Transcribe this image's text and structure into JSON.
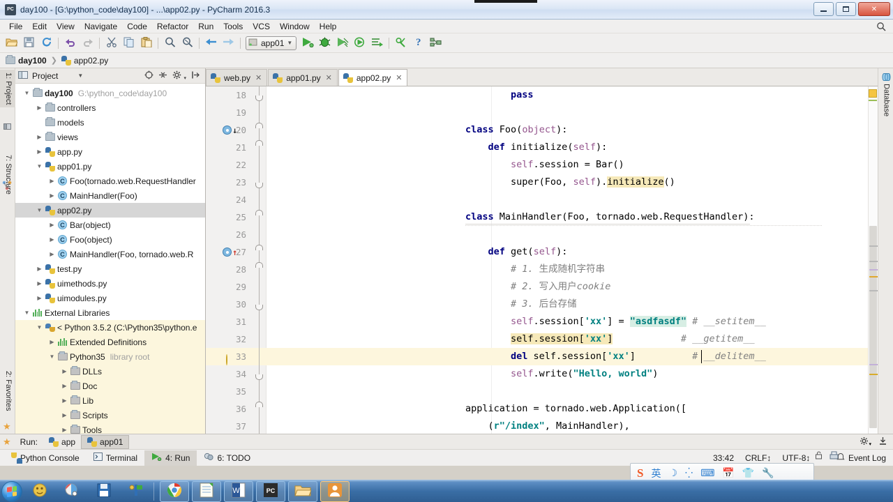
{
  "window": {
    "title": "day100 - [G:\\python_code\\day100] - ...\\app02.py - PyCharm 2016.3",
    "app_icon_label": "PC",
    "minimize_label": "Minimize",
    "maximize_label": "Maximize",
    "close_label": "✕"
  },
  "menu": {
    "items": [
      {
        "label": "File"
      },
      {
        "label": "Edit"
      },
      {
        "label": "View"
      },
      {
        "label": "Navigate"
      },
      {
        "label": "Code"
      },
      {
        "label": "Refactor"
      },
      {
        "label": "Run"
      },
      {
        "label": "Tools"
      },
      {
        "label": "VCS"
      },
      {
        "label": "Window"
      },
      {
        "label": "Help"
      }
    ],
    "search_icon": "search-icon"
  },
  "toolbar": {
    "run_config": "app01",
    "buttons": [
      {
        "name": "open-button",
        "glyph": "🗀"
      },
      {
        "name": "save-all-button",
        "glyph": "💾"
      },
      {
        "name": "sync-button",
        "glyph": "⟳"
      },
      {
        "name": "undo-button",
        "glyph": "↩"
      },
      {
        "name": "redo-button",
        "glyph": "↪"
      },
      {
        "name": "cut-button",
        "glyph": "✂"
      },
      {
        "name": "copy-button",
        "glyph": "⧉"
      },
      {
        "name": "paste-button",
        "glyph": "📋"
      },
      {
        "name": "find-button",
        "glyph": "🔍"
      },
      {
        "name": "replace-button",
        "glyph": "🔎"
      },
      {
        "name": "back-button",
        "glyph": "⬅"
      },
      {
        "name": "forward-button",
        "glyph": "➡"
      }
    ],
    "run_buttons": [
      {
        "name": "run-button",
        "glyph": "▶"
      },
      {
        "name": "debug-button",
        "glyph": "🐞"
      },
      {
        "name": "coverage-button",
        "glyph": "▦"
      },
      {
        "name": "profile-button",
        "glyph": "◷"
      },
      {
        "name": "attach-button",
        "glyph": "⤇"
      }
    ],
    "tail_buttons": [
      {
        "name": "settings-button",
        "glyph": "⚙"
      },
      {
        "name": "help-button",
        "glyph": "?"
      },
      {
        "name": "project-structure-button",
        "glyph": "▤"
      }
    ]
  },
  "breadcrumb": {
    "items": [
      {
        "label": "day100",
        "icon": "folder-icon",
        "bold": true
      },
      {
        "label": "app02.py",
        "icon": "python-file-icon",
        "bold": false
      }
    ]
  },
  "left_tool_tabs": [
    {
      "label": "1: Project",
      "selected": true
    },
    {
      "label": "7: Structure",
      "selected": false
    },
    {
      "label": "2: Favorites",
      "selected": false
    }
  ],
  "right_tool_tabs": [
    {
      "label": "Database",
      "selected": false
    }
  ],
  "project_panel": {
    "title": "Project",
    "header_icons": [
      "target-icon",
      "collapse-all-icon",
      "gear-icon",
      "hide-icon"
    ],
    "tree": [
      {
        "depth": 0,
        "arrow": "down",
        "icon": "folder-icon",
        "label": "day100",
        "sub": "G:\\python_code\\day100",
        "bold": true,
        "state": "normal"
      },
      {
        "depth": 1,
        "arrow": "right",
        "icon": "folder-icon",
        "label": "controllers",
        "sub": "",
        "bold": false,
        "state": "normal"
      },
      {
        "depth": 1,
        "arrow": "none",
        "icon": "folder-icon",
        "label": "models",
        "sub": "",
        "bold": false,
        "state": "normal"
      },
      {
        "depth": 1,
        "arrow": "right",
        "icon": "folder-icon",
        "label": "views",
        "sub": "",
        "bold": false,
        "state": "normal"
      },
      {
        "depth": 1,
        "arrow": "right",
        "icon": "python-file-icon",
        "label": "app.py",
        "sub": "",
        "bold": false,
        "state": "normal"
      },
      {
        "depth": 1,
        "arrow": "down",
        "icon": "python-file-icon",
        "label": "app01.py",
        "sub": "",
        "bold": false,
        "state": "normal"
      },
      {
        "depth": 2,
        "arrow": "right",
        "icon": "class-icon",
        "label": "Foo(tornado.web.RequestHandler",
        "sub": "",
        "bold": false,
        "state": "normal"
      },
      {
        "depth": 2,
        "arrow": "right",
        "icon": "class-icon",
        "label": "MainHandler(Foo)",
        "sub": "",
        "bold": false,
        "state": "normal"
      },
      {
        "depth": 1,
        "arrow": "down",
        "icon": "python-file-icon",
        "label": "app02.py",
        "sub": "",
        "bold": false,
        "state": "selected"
      },
      {
        "depth": 2,
        "arrow": "right",
        "icon": "class-icon",
        "label": "Bar(object)",
        "sub": "",
        "bold": false,
        "state": "normal"
      },
      {
        "depth": 2,
        "arrow": "right",
        "icon": "class-icon",
        "label": "Foo(object)",
        "sub": "",
        "bold": false,
        "state": "normal"
      },
      {
        "depth": 2,
        "arrow": "right",
        "icon": "class-icon",
        "label": "MainHandler(Foo, tornado.web.R",
        "sub": "",
        "bold": false,
        "state": "normal"
      },
      {
        "depth": 1,
        "arrow": "right",
        "icon": "python-file-icon",
        "label": "test.py",
        "sub": "",
        "bold": false,
        "state": "normal"
      },
      {
        "depth": 1,
        "arrow": "right",
        "icon": "python-file-icon",
        "label": "uimethods.py",
        "sub": "",
        "bold": false,
        "state": "normal"
      },
      {
        "depth": 1,
        "arrow": "right",
        "icon": "python-file-icon",
        "label": "uimodules.py",
        "sub": "",
        "bold": false,
        "state": "normal"
      },
      {
        "depth": 0,
        "arrow": "down",
        "icon": "library-icon",
        "label": "External Libraries",
        "sub": "",
        "bold": false,
        "state": "normal"
      },
      {
        "depth": 1,
        "arrow": "down",
        "icon": "interpreter-icon",
        "label": "< Python 3.5.2 (C:\\Python35\\python.e",
        "sub": "",
        "bold": false,
        "state": "lib"
      },
      {
        "depth": 2,
        "arrow": "right",
        "icon": "library-icon",
        "label": "Extended Definitions",
        "sub": "",
        "bold": false,
        "state": "lib"
      },
      {
        "depth": 2,
        "arrow": "down",
        "icon": "folder-grey-icon",
        "label": "Python35",
        "sub": "library root",
        "bold": false,
        "state": "lib"
      },
      {
        "depth": 3,
        "arrow": "right",
        "icon": "folder-grey-icon",
        "label": "DLLs",
        "sub": "",
        "bold": false,
        "state": "lib"
      },
      {
        "depth": 3,
        "arrow": "right",
        "icon": "folder-grey-icon",
        "label": "Doc",
        "sub": "",
        "bold": false,
        "state": "lib"
      },
      {
        "depth": 3,
        "arrow": "right",
        "icon": "folder-grey-icon",
        "label": "Lib",
        "sub": "",
        "bold": false,
        "state": "lib"
      },
      {
        "depth": 3,
        "arrow": "right",
        "icon": "folder-grey-icon",
        "label": "Scripts",
        "sub": "",
        "bold": false,
        "state": "lib"
      },
      {
        "depth": 3,
        "arrow": "right",
        "icon": "folder-grey-icon",
        "label": "Tools",
        "sub": "",
        "bold": false,
        "state": "lib"
      }
    ]
  },
  "editor": {
    "tabs": [
      {
        "label": "web.py",
        "active": false,
        "close": "✕"
      },
      {
        "label": "app01.py",
        "active": false,
        "close": "✕"
      },
      {
        "label": "app02.py",
        "active": true,
        "close": "✕"
      }
    ],
    "lines": [
      {
        "num": "18",
        "marker": "",
        "fold": "cap-bot",
        "highlight": false,
        "tokens": [
          {
            "t": "        ",
            "c": "plain"
          },
          {
            "t": "pass",
            "c": "kw"
          }
        ]
      },
      {
        "num": "19",
        "marker": "",
        "fold": "",
        "highlight": false,
        "tokens": []
      },
      {
        "num": "20",
        "marker": "override-down",
        "fold": "cap-top",
        "highlight": false,
        "tokens": [
          {
            "t": "class ",
            "c": "kw"
          },
          {
            "t": "Foo",
            "c": "plain"
          },
          {
            "t": "(",
            "c": "plain"
          },
          {
            "t": "object",
            "c": "slf"
          },
          {
            "t": "):",
            "c": "plain"
          }
        ]
      },
      {
        "num": "21",
        "marker": "",
        "fold": "cap-top",
        "highlight": false,
        "tokens": [
          {
            "t": "    ",
            "c": "plain"
          },
          {
            "t": "def ",
            "c": "kw"
          },
          {
            "t": "initialize",
            "c": "plain"
          },
          {
            "t": "(",
            "c": "plain"
          },
          {
            "t": "self",
            "c": "slf"
          },
          {
            "t": "):",
            "c": "plain"
          }
        ]
      },
      {
        "num": "22",
        "marker": "",
        "fold": "",
        "highlight": false,
        "tokens": [
          {
            "t": "        ",
            "c": "plain"
          },
          {
            "t": "self",
            "c": "slf"
          },
          {
            "t": ".session = Bar()",
            "c": "plain"
          }
        ]
      },
      {
        "num": "23",
        "marker": "",
        "fold": "cap-bot",
        "highlight": false,
        "tokens": [
          {
            "t": "        super(Foo, ",
            "c": "plain"
          },
          {
            "t": "self",
            "c": "slf"
          },
          {
            "t": ").",
            "c": "plain"
          },
          {
            "t": "initialize",
            "c": "hlident"
          },
          {
            "t": "()",
            "c": "plain"
          }
        ]
      },
      {
        "num": "24",
        "marker": "",
        "fold": "",
        "highlight": false,
        "tokens": []
      },
      {
        "num": "25",
        "marker": "",
        "fold": "cap-top",
        "highlight": false,
        "tokens": [
          {
            "t": "class ",
            "c": "kw"
          },
          {
            "t": "MainHandler",
            "c": "plain"
          },
          {
            "t": "(Foo, tornado.web.RequestHandler):",
            "c": "plain"
          }
        ]
      },
      {
        "num": "26",
        "marker": "",
        "fold": "",
        "highlight": false,
        "tokens": []
      },
      {
        "num": "27",
        "marker": "implement-up",
        "fold": "cap-top",
        "highlight": false,
        "tokens": [
          {
            "t": "    ",
            "c": "plain"
          },
          {
            "t": "def ",
            "c": "kw"
          },
          {
            "t": "get",
            "c": "plain"
          },
          {
            "t": "(",
            "c": "plain"
          },
          {
            "t": "self",
            "c": "slf"
          },
          {
            "t": "):",
            "c": "plain"
          }
        ]
      },
      {
        "num": "28",
        "marker": "",
        "fold": "cap-top",
        "highlight": false,
        "tokens": [
          {
            "t": "        ",
            "c": "plain"
          },
          {
            "t": "# 1. ",
            "c": "cmt"
          },
          {
            "t": "生成随机字符串",
            "c": "cmt-cn"
          }
        ]
      },
      {
        "num": "29",
        "marker": "",
        "fold": "",
        "highlight": false,
        "tokens": [
          {
            "t": "        ",
            "c": "plain"
          },
          {
            "t": "# 2. ",
            "c": "cmt"
          },
          {
            "t": "写入用户",
            "c": "cmt-cn"
          },
          {
            "t": "cookie",
            "c": "cmt"
          }
        ]
      },
      {
        "num": "30",
        "marker": "",
        "fold": "cap-bot",
        "highlight": false,
        "tokens": [
          {
            "t": "        ",
            "c": "plain"
          },
          {
            "t": "# 3. ",
            "c": "cmt"
          },
          {
            "t": "后台存储",
            "c": "cmt-cn"
          }
        ]
      },
      {
        "num": "31",
        "marker": "",
        "fold": "",
        "highlight": false,
        "tokens": [
          {
            "t": "        ",
            "c": "plain"
          },
          {
            "t": "self",
            "c": "slf"
          },
          {
            "t": ".session[",
            "c": "plain"
          },
          {
            "t": "'xx'",
            "c": "str"
          },
          {
            "t": "] = ",
            "c": "plain"
          },
          {
            "t": "\"asdfasdf\"",
            "c": "str hlstr"
          },
          {
            "t": " ",
            "c": "plain"
          },
          {
            "t": "# __setitem__",
            "c": "cmt"
          }
        ]
      },
      {
        "num": "32",
        "marker": "",
        "fold": "",
        "highlight": false,
        "tokens": [
          {
            "t": "        ",
            "c": "plain"
          },
          {
            "t": "self.session[",
            "c": "plain hlident"
          },
          {
            "t": "'xx'",
            "c": "str hlident"
          },
          {
            "t": "]",
            "c": "plain hlident"
          },
          {
            "t": "            ",
            "c": "plain"
          },
          {
            "t": "# __getitem__",
            "c": "cmt"
          }
        ]
      },
      {
        "num": "33",
        "marker": "intention-bulb",
        "fold": "",
        "highlight": true,
        "tokens": [
          {
            "t": "        ",
            "c": "plain"
          },
          {
            "t": "del ",
            "c": "kw"
          },
          {
            "t": "self.session[",
            "c": "plain"
          },
          {
            "t": "'xx'",
            "c": "str"
          },
          {
            "t": "]",
            "c": "plain"
          },
          {
            "t": "          ",
            "c": "plain"
          },
          {
            "t": "# __delitem__",
            "c": "cmt"
          }
        ]
      },
      {
        "num": "34",
        "marker": "",
        "fold": "cap-bot",
        "highlight": false,
        "tokens": [
          {
            "t": "        ",
            "c": "plain"
          },
          {
            "t": "self",
            "c": "slf"
          },
          {
            "t": ".write(",
            "c": "plain"
          },
          {
            "t": "\"Hello, world\"",
            "c": "str"
          },
          {
            "t": ")",
            "c": "plain"
          }
        ]
      },
      {
        "num": "35",
        "marker": "",
        "fold": "",
        "highlight": false,
        "tokens": []
      },
      {
        "num": "36",
        "marker": "",
        "fold": "cap-top",
        "highlight": false,
        "tokens": [
          {
            "t": "application = tornado.web.Application([",
            "c": "plain"
          }
        ]
      },
      {
        "num": "37",
        "marker": "",
        "fold": "",
        "highlight": false,
        "tokens": [
          {
            "t": "    (",
            "c": "plain"
          },
          {
            "t": "r\"/index\"",
            "c": "str"
          },
          {
            "t": ", MainHandler),",
            "c": "plain"
          }
        ]
      }
    ]
  },
  "run_toolbar": {
    "label": "Run:",
    "tabs": [
      {
        "label": "app",
        "selected": false
      },
      {
        "label": "app01",
        "selected": true
      }
    ],
    "right_icons": [
      "gear-icon",
      "hide-icon"
    ]
  },
  "status_tabs": [
    {
      "label": "Python Console",
      "icon": "python-icon",
      "selected": false
    },
    {
      "label": "Terminal",
      "icon": "terminal-icon",
      "selected": false
    },
    {
      "label": "4: Run",
      "icon": "run-icon",
      "selected": true
    },
    {
      "label": "6: TODO",
      "icon": "todo-icon",
      "selected": false
    }
  ],
  "status_right": {
    "event_log": "Event Log"
  },
  "ime": {
    "logo": "S",
    "items": [
      "英",
      "☽",
      "⁛",
      "⌨",
      "📅",
      "👕",
      "🔧"
    ]
  },
  "editor_status": {
    "position": "33:42",
    "line_sep": "CRLF↕",
    "encoding": "UTF-8↕",
    "lock_icon": "lock-icon",
    "vcs_icon": "vcs-icon"
  },
  "taskbar": {
    "start_label": "Start",
    "items": [
      {
        "name": "taskbar-app-media",
        "glyph": "🎨",
        "state": "plain"
      },
      {
        "name": "taskbar-app-paint",
        "glyph": "🖌",
        "state": "plain"
      },
      {
        "name": "taskbar-app-save",
        "glyph": "💾",
        "state": "plain"
      },
      {
        "name": "taskbar-app-tool",
        "glyph": "🔌",
        "state": "plain"
      },
      {
        "name": "taskbar-app-chrome",
        "glyph": "◉",
        "state": "framed"
      },
      {
        "name": "taskbar-app-notepad",
        "glyph": "📝",
        "state": "framed"
      },
      {
        "name": "taskbar-app-word",
        "glyph": "W",
        "state": "framed"
      },
      {
        "name": "taskbar-app-pycharm",
        "glyph": "PC",
        "state": "framed"
      },
      {
        "name": "taskbar-app-explorer",
        "glyph": "🗂",
        "state": "framed"
      },
      {
        "name": "taskbar-app-foxmail",
        "glyph": "👤",
        "state": "active"
      }
    ]
  }
}
